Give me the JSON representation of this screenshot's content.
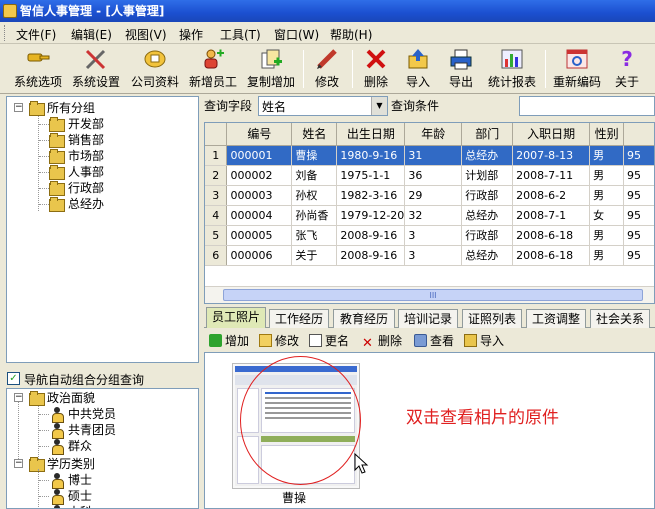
{
  "window": {
    "title": "智信人事管理 - [人事管理]"
  },
  "menu": [
    "文件(F)",
    "编辑(E)",
    "视图(V)",
    "操作",
    "工具(T)",
    "窗口(W)",
    "帮助(H)"
  ],
  "toolbar": [
    {
      "label": "系统选项",
      "icon": "key-icon"
    },
    {
      "label": "系统设置",
      "icon": "tools-icon"
    },
    {
      "label": "公司资料",
      "icon": "company-icon"
    },
    {
      "label": "新增员工",
      "icon": "add-user-icon"
    },
    {
      "label": "复制增加",
      "icon": "copy-add-icon"
    },
    {
      "label": "修改",
      "icon": "pencil-icon"
    },
    {
      "label": "删除",
      "icon": "delete-x-icon"
    },
    {
      "label": "导入",
      "icon": "import-icon"
    },
    {
      "label": "导出",
      "icon": "export-printer-icon"
    },
    {
      "label": "统计报表",
      "icon": "chart-icon"
    },
    {
      "label": "重新编码",
      "icon": "recode-icon"
    },
    {
      "label": "关于",
      "icon": "help-icon"
    }
  ],
  "tree": {
    "root": "所有分组",
    "items": [
      "开发部",
      "销售部",
      "市场部",
      "人事部",
      "行政部",
      "总经办"
    ]
  },
  "nav_auto": {
    "label": "导航自动组合分组查询",
    "checked": true
  },
  "tree2": {
    "group1": "政治面貌",
    "group1_items": [
      "中共党员",
      "共青团员",
      "群众"
    ],
    "group2": "学历类别",
    "group2_items": [
      "博士",
      "硕士",
      "本科"
    ]
  },
  "query": {
    "field_label": "查询字段",
    "field_value": "姓名",
    "cond_label": "查询条件",
    "cond_value": ""
  },
  "grid": {
    "columns": [
      "编号",
      "姓名",
      "出生日期",
      "年龄",
      "部门",
      "入职日期",
      "性别",
      ""
    ],
    "rows": [
      {
        "n": "1",
        "cells": [
          "000001",
          "曹操",
          "1980-9-16",
          "31",
          "总经办",
          "2007-8-13",
          "男",
          "95"
        ]
      },
      {
        "n": "2",
        "cells": [
          "000002",
          "刘备",
          "1975-1-1",
          "36",
          "计划部",
          "2008-7-11",
          "男",
          "95"
        ]
      },
      {
        "n": "3",
        "cells": [
          "000003",
          "孙权",
          "1982-3-16",
          "29",
          "行政部",
          "2008-6-2",
          "男",
          "95"
        ]
      },
      {
        "n": "4",
        "cells": [
          "000004",
          "孙尚香",
          "1979-12-20",
          "32",
          "总经办",
          "2008-7-1",
          "女",
          "95"
        ]
      },
      {
        "n": "5",
        "cells": [
          "000005",
          "张飞",
          "2008-9-16",
          "3",
          "行政部",
          "2008-6-18",
          "男",
          "95"
        ]
      },
      {
        "n": "6",
        "cells": [
          "000006",
          "关于",
          "2008-9-16",
          "3",
          "总经办",
          "2008-6-18",
          "男",
          "95"
        ]
      }
    ],
    "scroll_marker": "III"
  },
  "tabs": [
    "员工照片",
    "工作经历",
    "教育经历",
    "培训记录",
    "证照列表",
    "工资调整",
    "社会关系"
  ],
  "photo_toolbar": [
    {
      "label": "增加",
      "icon": "plus-icon"
    },
    {
      "label": "修改",
      "icon": "edit-icon"
    },
    {
      "label": "更名",
      "icon": "rename-icon"
    },
    {
      "label": "删除",
      "icon": "delete-icon"
    },
    {
      "label": "查看",
      "icon": "view-icon"
    },
    {
      "label": "导入",
      "icon": "import-icon"
    }
  ],
  "photo": {
    "caption": "曹操"
  },
  "annotation": {
    "text": "双击查看相片的原件",
    "color": "#e02020"
  },
  "colors": {
    "selection": "#316ac5",
    "titlebar": "#1b4fd0"
  }
}
